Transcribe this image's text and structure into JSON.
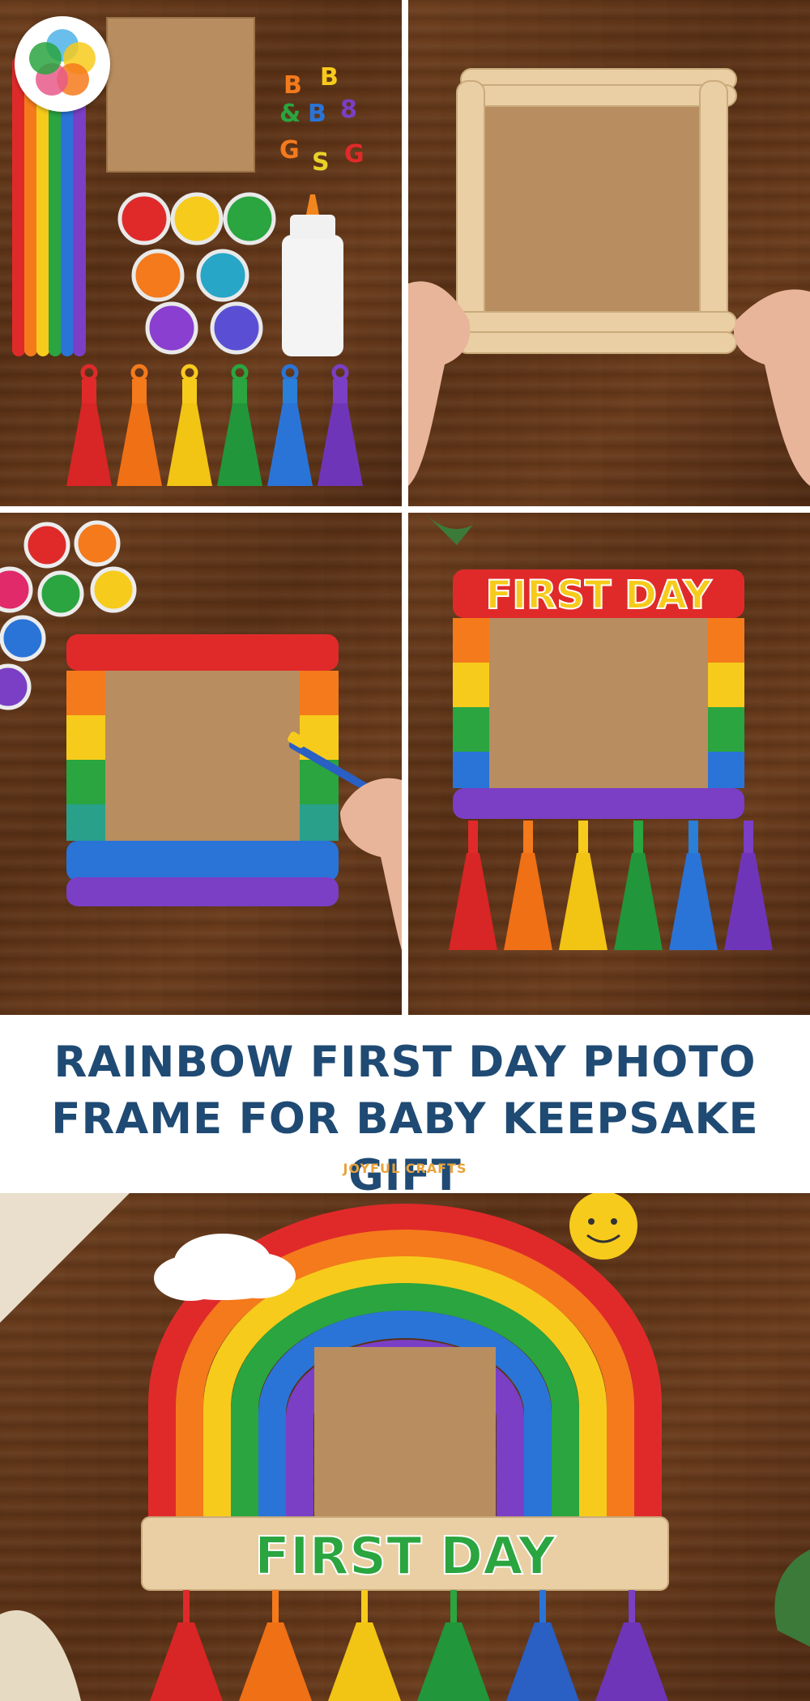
{
  "title": {
    "line1": "RAINBOW FIRST DAY PHOTO",
    "line2": "FRAME FOR BABY KEEPSAKE GIFT"
  },
  "brand": "JOYFUL CRAFTS",
  "frame_words": {
    "panel4": "FIRST DAY",
    "final": "FIRST DAY"
  },
  "colors": {
    "title": "#1f4a73",
    "brand": "#e8a23a",
    "red": "#e02a2a",
    "orange": "#f47a1c",
    "yellow": "#f7cb1c",
    "green": "#2aa53f",
    "blue": "#2a74d8",
    "purple": "#7a3fc4"
  }
}
